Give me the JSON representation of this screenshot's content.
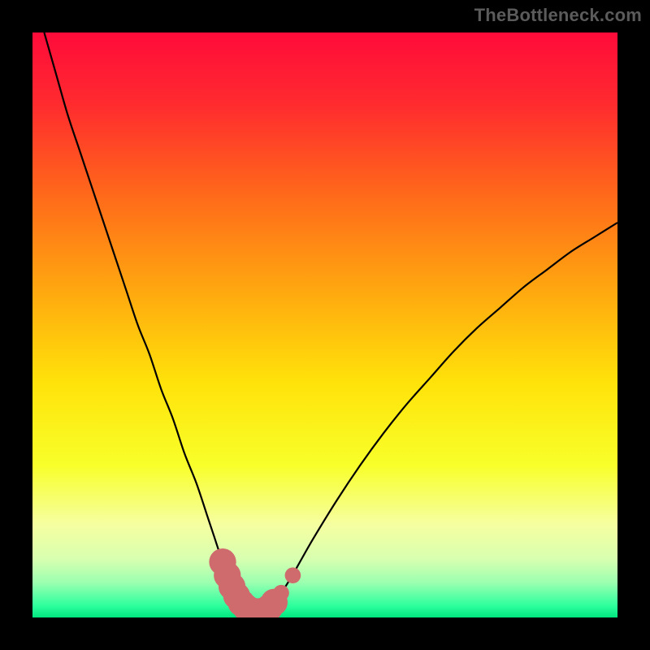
{
  "watermark": {
    "text": "TheBottleneck.com"
  },
  "colors": {
    "frame": "#000000",
    "curve": "#000000",
    "marker_fill": "#cf6a6d",
    "marker_stroke": "#cf6a6d",
    "gradient_stops": [
      {
        "offset": 0.0,
        "color": "#ff0b3a"
      },
      {
        "offset": 0.12,
        "color": "#ff2a2f"
      },
      {
        "offset": 0.28,
        "color": "#ff6a1a"
      },
      {
        "offset": 0.45,
        "color": "#ffab0f"
      },
      {
        "offset": 0.6,
        "color": "#ffe30a"
      },
      {
        "offset": 0.74,
        "color": "#f8ff2a"
      },
      {
        "offset": 0.84,
        "color": "#f6ffa0"
      },
      {
        "offset": 0.9,
        "color": "#d8ffb0"
      },
      {
        "offset": 0.94,
        "color": "#9cffb0"
      },
      {
        "offset": 0.98,
        "color": "#2dff9d"
      },
      {
        "offset": 1.0,
        "color": "#00e57f"
      }
    ]
  },
  "chart_data": {
    "type": "line",
    "title": "",
    "xlabel": "",
    "ylabel": "",
    "xlim": [
      0,
      100
    ],
    "ylim": [
      0,
      100
    ],
    "grid": false,
    "legend": false,
    "series": [
      {
        "name": "bottleneck-curve",
        "x": [
          2,
          4,
          6,
          8,
          10,
          12,
          14,
          16,
          18,
          20,
          22,
          24,
          26,
          28,
          30,
          31,
          32,
          33,
          34,
          35,
          36,
          37,
          38,
          39,
          40,
          42,
          44,
          46,
          48,
          52,
          56,
          60,
          64,
          68,
          72,
          76,
          80,
          84,
          88,
          92,
          96,
          100
        ],
        "y": [
          100,
          93,
          86,
          80,
          74,
          68,
          62,
          56,
          50,
          45,
          39,
          34,
          28,
          23,
          17,
          14,
          11,
          8.5,
          6.0,
          4.0,
          2.5,
          1.5,
          1.0,
          1.0,
          1.5,
          3.5,
          6.5,
          10.0,
          13.5,
          20.0,
          26.0,
          31.5,
          36.5,
          41.0,
          45.5,
          49.5,
          53.0,
          56.5,
          59.5,
          62.5,
          65.0,
          67.5
        ]
      }
    ],
    "markers": {
      "name": "highlight-region",
      "color": "#cf6a6d",
      "points": [
        {
          "x": 32.5,
          "y": 9.5,
          "r": 2.2
        },
        {
          "x": 33.3,
          "y": 7.2,
          "r": 2.2
        },
        {
          "x": 34.1,
          "y": 5.3,
          "r": 2.2
        },
        {
          "x": 34.9,
          "y": 3.7,
          "r": 2.2
        },
        {
          "x": 35.7,
          "y": 2.5,
          "r": 2.2
        },
        {
          "x": 36.5,
          "y": 1.7,
          "r": 2.2
        },
        {
          "x": 37.3,
          "y": 1.2,
          "r": 2.2
        },
        {
          "x": 38.1,
          "y": 1.0,
          "r": 2.2
        },
        {
          "x": 38.9,
          "y": 1.0,
          "r": 2.2
        },
        {
          "x": 39.7,
          "y": 1.2,
          "r": 2.2
        },
        {
          "x": 40.5,
          "y": 1.7,
          "r": 2.2
        },
        {
          "x": 41.3,
          "y": 2.6,
          "r": 2.2
        },
        {
          "x": 42.5,
          "y": 4.2,
          "r": 1.3
        },
        {
          "x": 44.5,
          "y": 7.2,
          "r": 1.3
        }
      ]
    }
  }
}
